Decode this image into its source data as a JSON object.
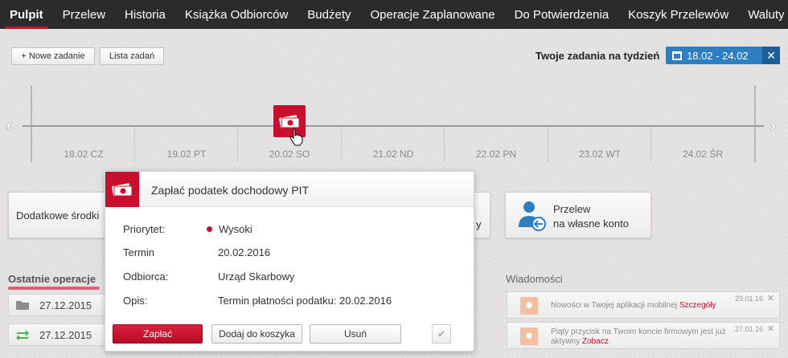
{
  "nav": {
    "items": [
      {
        "label": "Pulpit",
        "active": true
      },
      {
        "label": "Przelew"
      },
      {
        "label": "Historia"
      },
      {
        "label": "Książka Odbiorców"
      },
      {
        "label": "Budżety"
      },
      {
        "label": "Operacje Zaplanowane"
      },
      {
        "label": "Do Potwierdzenia"
      },
      {
        "label": "Koszyk Przelewów"
      },
      {
        "label": "Waluty"
      }
    ]
  },
  "toolbar": {
    "new_task": "+ Nowe zadanie",
    "task_list": "Lista zadań",
    "week_label": "Twoje zadania na tydzień",
    "week_range": "18.02 - 24.02",
    "close": "✕"
  },
  "timeline": {
    "days": [
      "18.02 CZ",
      "19.02 PT",
      "20.02 SO",
      "21.02 ND",
      "22.02 PN",
      "23.02 WT",
      "24.02 ŚR"
    ],
    "prev": "‹",
    "next": "›"
  },
  "tiles": {
    "left_label": "Dodatkowe środki",
    "middle_fragment": "y",
    "transfer_line1": "Przelew",
    "transfer_line2": "na własne konto"
  },
  "recent_ops": {
    "title": "Ostatnie operacje",
    "rows": [
      {
        "date": "27.12.2015",
        "icon": "folder-icon"
      },
      {
        "date": "27.12.2015",
        "icon": "transfer-arrows-icon"
      }
    ]
  },
  "messages": {
    "title": "Wiadomości",
    "items": [
      {
        "text": "Nowości w Twojej aplikacji mobilnej ",
        "link": "Szczegóły",
        "date": "29.01.16"
      },
      {
        "text": "Piąty przycisk na Twoim koncie firmowym jest już aktywny ",
        "link": "Zobacz",
        "date": "27.01.16"
      }
    ]
  },
  "popup": {
    "title": "Zapłać podatek dochodowy PIT",
    "fields": [
      {
        "label": "Priorytet:",
        "value": "Wysoki"
      },
      {
        "label": "Termin",
        "value": "20.02.2016"
      },
      {
        "label": "Odbiorca:",
        "value": "Urząd Skarbowy"
      },
      {
        "label": "Opis:",
        "value": "Termin płatności podatku: 20.02.2016"
      }
    ],
    "buttons": {
      "pay": "Zapłać",
      "add_to_cart": "Dodaj do koszyka",
      "remove": "Usuń",
      "done": "✔"
    }
  },
  "colors": {
    "accent": "#c8102e",
    "nav_bg": "#2b2b2b",
    "week_badge": "#2e7fc2"
  }
}
